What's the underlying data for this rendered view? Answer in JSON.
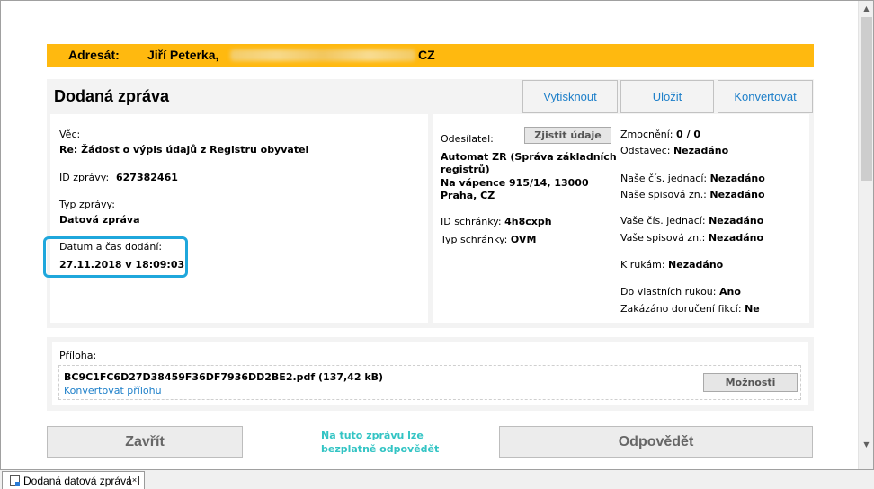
{
  "address": {
    "label": "Adresát:",
    "name": "Jiří Peterka,",
    "country": "CZ"
  },
  "message": {
    "title": "Dodaná zpráva",
    "buttons": {
      "print": "Vytisknout",
      "save": "Uložit",
      "convert": "Konvertovat"
    },
    "subject_label": "Věc:",
    "subject_value": "Re: Žádost o výpis údajů z Registru obyvatel",
    "id_label": "ID zprávy:",
    "id_value": "627382461",
    "type_label": "Typ zprávy:",
    "type_value": "Datová zpráva",
    "delivered_label": "Datum a čas dodání:",
    "delivered_value": "27.11.2018 v 18:09:03"
  },
  "sender": {
    "label": "Odesílatel:",
    "lookup_button": "Zjistit údaje",
    "name_line1": "Automat ZR (Správa základních",
    "name_line2": "registrů)",
    "address_line1": "Na vápence 915/14, 13000",
    "address_line2": "Praha, CZ",
    "box_id_label": "ID schránky:",
    "box_id_value": "4h8cxph",
    "box_type_label": "Typ schránky:",
    "box_type_value": "OVM"
  },
  "details": {
    "authorization_label": "Zmocnění:",
    "authorization_value": "0 / 0",
    "paragraph_label": "Odstavec:",
    "paragraph_value": "Nezadáno",
    "our_ref_label": "Naše čís. jednací:",
    "our_ref_value": "Nezadáno",
    "our_file_label": "Naše spisová zn.:",
    "our_file_value": "Nezadáno",
    "your_ref_label": "Vaše čís. jednací:",
    "your_ref_value": "Nezadáno",
    "your_file_label": "Vaše spisová zn.:",
    "your_file_value": "Nezadáno",
    "attention_label": "K rukám:",
    "attention_value": "Nezadáno",
    "personal_label": "Do vlastních rukou:",
    "personal_value": "Ano",
    "fiction_label": "Zakázáno doručení fikcí:",
    "fiction_value": "Ne"
  },
  "attachment": {
    "label": "Příloha:",
    "file": "BC9C1FC6D27D38459F36DF7936DD2BE2.pdf (137,42 kB)",
    "convert_link": "Konvertovat přílohu",
    "options_button": "Možnosti"
  },
  "footer": {
    "close_button": "Zavřít",
    "note": "Na tuto zprávu lze bezplatně odpovědět",
    "reply_button": "Odpovědět"
  },
  "tab": {
    "label": "Dodaná datová zpráva",
    "close": "×"
  },
  "icons": {
    "scroll_up": "scroll-up-arrow-icon",
    "scroll_down": "scroll-down-arrow-icon",
    "document": "document-icon",
    "close": "close-icon"
  },
  "colors": {
    "address_bar": "#ffb90f",
    "accent": "#1d7fc9",
    "highlight": "#1fa7dc",
    "note": "#33c4c4"
  }
}
